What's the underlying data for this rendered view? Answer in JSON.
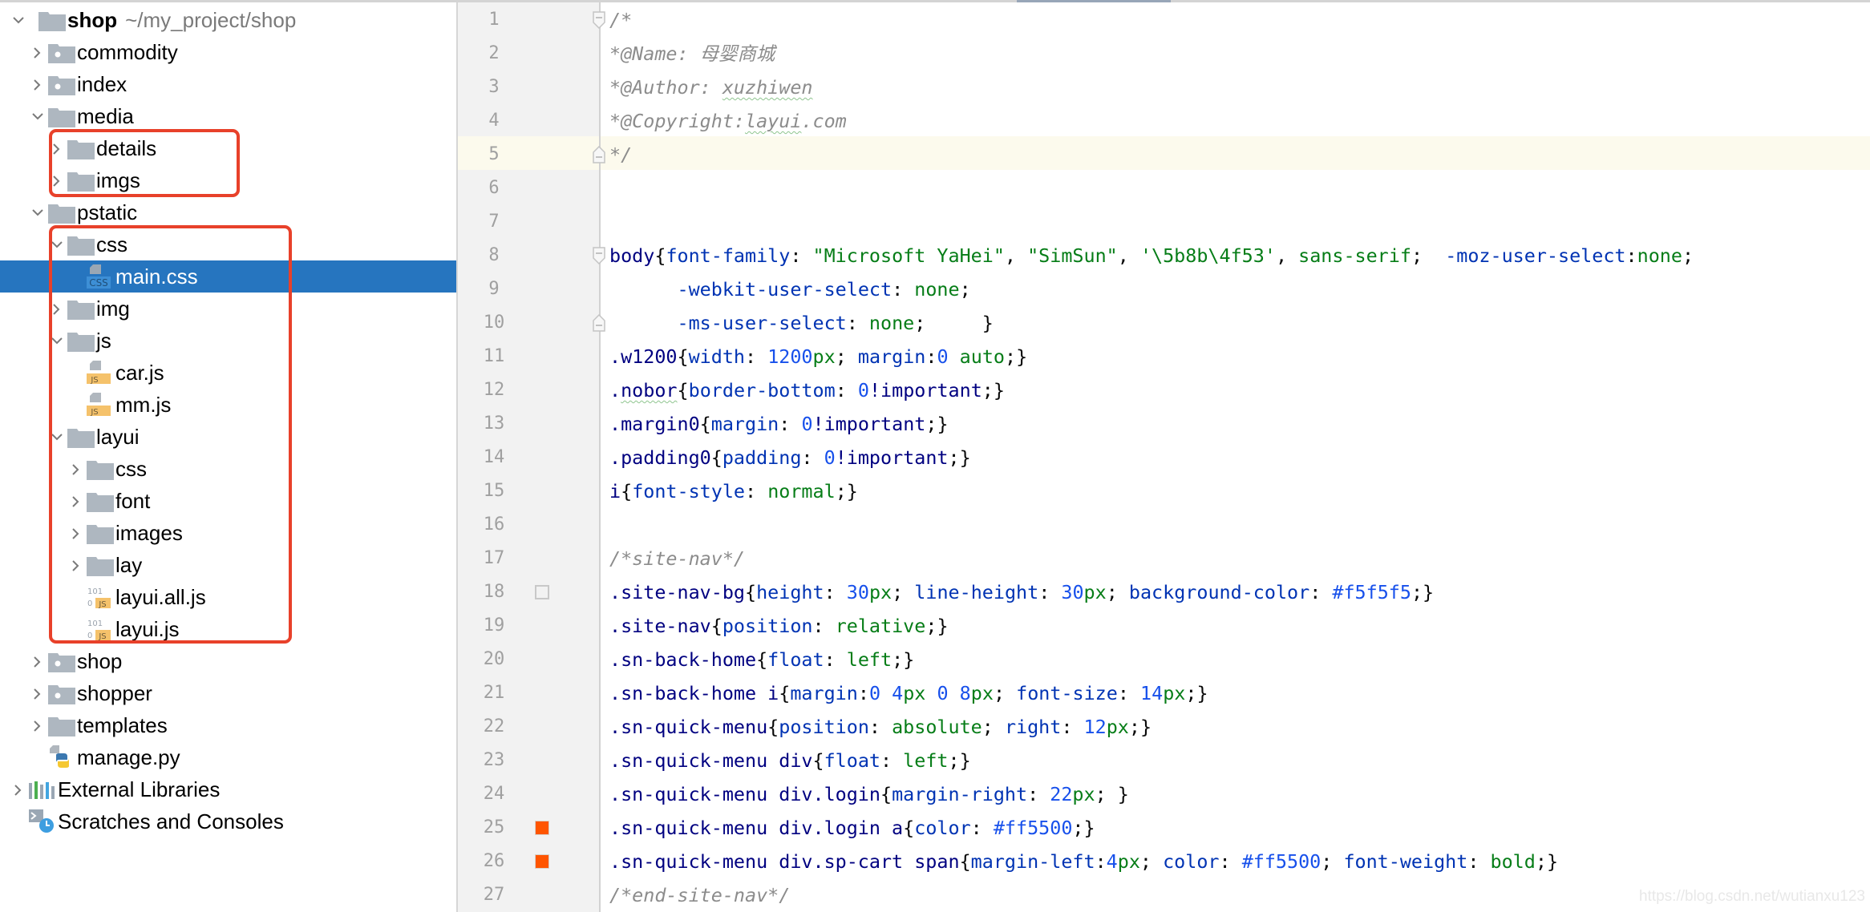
{
  "project_tree": {
    "root": {
      "label": "shop",
      "path": "~/my_project/shop"
    },
    "rows": [
      {
        "label": "commodity",
        "depth": 1,
        "kind": "module",
        "state": "collapsed"
      },
      {
        "label": "index",
        "depth": 1,
        "kind": "module",
        "state": "collapsed"
      },
      {
        "label": "media",
        "depth": 1,
        "kind": "folder",
        "state": "expanded"
      },
      {
        "label": "details",
        "depth": 2,
        "kind": "folder",
        "state": "collapsed"
      },
      {
        "label": "imgs",
        "depth": 2,
        "kind": "folder",
        "state": "collapsed"
      },
      {
        "label": "pstatic",
        "depth": 1,
        "kind": "folder",
        "state": "expanded"
      },
      {
        "label": "css",
        "depth": 2,
        "kind": "folder",
        "state": "expanded"
      },
      {
        "label": "main.css",
        "depth": 3,
        "kind": "css-file",
        "state": "leaf",
        "selected": true
      },
      {
        "label": "img",
        "depth": 2,
        "kind": "folder",
        "state": "collapsed"
      },
      {
        "label": "js",
        "depth": 2,
        "kind": "folder",
        "state": "expanded"
      },
      {
        "label": "car.js",
        "depth": 3,
        "kind": "js-file",
        "state": "leaf"
      },
      {
        "label": "mm.js",
        "depth": 3,
        "kind": "js-file",
        "state": "leaf"
      },
      {
        "label": "layui",
        "depth": 2,
        "kind": "folder",
        "state": "expanded"
      },
      {
        "label": "css",
        "depth": 3,
        "kind": "folder",
        "state": "collapsed"
      },
      {
        "label": "font",
        "depth": 3,
        "kind": "folder",
        "state": "collapsed"
      },
      {
        "label": "images",
        "depth": 3,
        "kind": "folder",
        "state": "collapsed"
      },
      {
        "label": "lay",
        "depth": 3,
        "kind": "folder",
        "state": "collapsed"
      },
      {
        "label": "layui.all.js",
        "depth": 3,
        "kind": "min-js-file",
        "state": "leaf"
      },
      {
        "label": "layui.js",
        "depth": 3,
        "kind": "min-js-file",
        "state": "leaf"
      },
      {
        "label": "shop",
        "depth": 1,
        "kind": "module",
        "state": "collapsed"
      },
      {
        "label": "shopper",
        "depth": 1,
        "kind": "module",
        "state": "collapsed"
      },
      {
        "label": "templates",
        "depth": 1,
        "kind": "folder",
        "state": "collapsed"
      },
      {
        "label": "manage.py",
        "depth": 1,
        "kind": "python-file",
        "state": "leaf"
      },
      {
        "label": "External Libraries",
        "depth": 0,
        "kind": "libraries",
        "state": "collapsed"
      },
      {
        "label": "Scratches and Consoles",
        "depth": 0,
        "kind": "scratches",
        "state": "leaf"
      }
    ],
    "highlight_boxes": [
      {
        "covers": [
          "details",
          "imgs"
        ],
        "color": "#e8412a"
      },
      {
        "covers": [
          "css",
          "main.css",
          "img",
          "js",
          "car.js",
          "mm.js",
          "layui",
          "css",
          "font",
          "images",
          "lay",
          "layui.all.js",
          "layui.js"
        ],
        "color": "#e8412a"
      }
    ]
  },
  "editor": {
    "file": "main.css",
    "current_line": 5,
    "gutter_markers": [
      {
        "line": 18,
        "type": "empty-square"
      },
      {
        "line": 25,
        "type": "color",
        "color": "#ff5500"
      },
      {
        "line": 26,
        "type": "color",
        "color": "#ff5500"
      }
    ],
    "fold_markers": [
      {
        "line": 1,
        "type": "start"
      },
      {
        "line": 5,
        "type": "end"
      },
      {
        "line": 8,
        "type": "start"
      },
      {
        "line": 10,
        "type": "end"
      }
    ],
    "lines": [
      [
        [
          "com",
          "/*"
        ]
      ],
      [
        [
          "com",
          "*@Name: 母婴商城"
        ]
      ],
      [
        [
          "com",
          "*@Author: "
        ],
        [
          "com-typo",
          "xuzhiwen"
        ]
      ],
      [
        [
          "com",
          "*@Copyright:"
        ],
        [
          "com-typo",
          "layui"
        ],
        [
          "com",
          ".com"
        ]
      ],
      [
        [
          "com",
          "*/"
        ]
      ],
      [],
      [],
      [
        [
          "sel",
          "body"
        ],
        [
          "punc",
          "{"
        ],
        [
          "prop",
          "font-family"
        ],
        [
          "punc",
          ": "
        ],
        [
          "str",
          "\"Microsoft YaHei\""
        ],
        [
          "punc",
          ", "
        ],
        [
          "str",
          "\"SimSun\""
        ],
        [
          "punc",
          ", "
        ],
        [
          "str",
          "'\\5b8b\\4f53'"
        ],
        [
          "punc",
          ", "
        ],
        [
          "val",
          "sans-serif"
        ],
        [
          "punc",
          ";  "
        ],
        [
          "prop",
          "-moz-user-select"
        ],
        [
          "punc",
          ":"
        ],
        [
          "val",
          "none"
        ],
        [
          "punc",
          ";"
        ]
      ],
      [
        [
          "punc",
          "      "
        ],
        [
          "prop",
          "-webkit-user-select"
        ],
        [
          "punc",
          ": "
        ],
        [
          "val",
          "none"
        ],
        [
          "punc",
          ";"
        ]
      ],
      [
        [
          "punc",
          "      "
        ],
        [
          "prop",
          "-ms-user-select"
        ],
        [
          "punc",
          ": "
        ],
        [
          "val",
          "none"
        ],
        [
          "punc",
          ";     }"
        ]
      ],
      [
        [
          "sel",
          ".w1200"
        ],
        [
          "punc",
          "{"
        ],
        [
          "prop",
          "width"
        ],
        [
          "punc",
          ": "
        ],
        [
          "num",
          "1200"
        ],
        [
          "unit",
          "px"
        ],
        [
          "punc",
          "; "
        ],
        [
          "prop",
          "margin"
        ],
        [
          "punc",
          ":"
        ],
        [
          "num",
          "0"
        ],
        [
          "punc",
          " "
        ],
        [
          "val",
          "auto"
        ],
        [
          "punc",
          ";}"
        ]
      ],
      [
        [
          "sel",
          "."
        ],
        [
          "sel-typo",
          "nobor"
        ],
        [
          "punc",
          "{"
        ],
        [
          "prop",
          "border-bottom"
        ],
        [
          "punc",
          ": "
        ],
        [
          "num",
          "0"
        ],
        [
          "imp",
          "!important"
        ],
        [
          "punc",
          ";}"
        ]
      ],
      [
        [
          "sel",
          ".margin0"
        ],
        [
          "punc",
          "{"
        ],
        [
          "prop",
          "margin"
        ],
        [
          "punc",
          ": "
        ],
        [
          "num",
          "0"
        ],
        [
          "imp",
          "!important"
        ],
        [
          "punc",
          ";}"
        ]
      ],
      [
        [
          "sel",
          ".padding0"
        ],
        [
          "punc",
          "{"
        ],
        [
          "prop",
          "padding"
        ],
        [
          "punc",
          ": "
        ],
        [
          "num",
          "0"
        ],
        [
          "imp",
          "!important"
        ],
        [
          "punc",
          ";}"
        ]
      ],
      [
        [
          "sel",
          "i"
        ],
        [
          "punc",
          "{"
        ],
        [
          "prop",
          "font-style"
        ],
        [
          "punc",
          ": "
        ],
        [
          "val",
          "normal"
        ],
        [
          "punc",
          ";}"
        ]
      ],
      [],
      [
        [
          "com",
          "/*site-nav*/"
        ]
      ],
      [
        [
          "sel",
          ".site-nav-bg"
        ],
        [
          "punc",
          "{"
        ],
        [
          "prop",
          "height"
        ],
        [
          "punc",
          ": "
        ],
        [
          "num",
          "30"
        ],
        [
          "unit",
          "px"
        ],
        [
          "punc",
          "; "
        ],
        [
          "prop",
          "line-height"
        ],
        [
          "punc",
          ": "
        ],
        [
          "num",
          "30"
        ],
        [
          "unit",
          "px"
        ],
        [
          "punc",
          "; "
        ],
        [
          "prop",
          "background-color"
        ],
        [
          "punc",
          ": "
        ],
        [
          "hex",
          "#f5f5f5"
        ],
        [
          "punc",
          ";}"
        ]
      ],
      [
        [
          "sel",
          ".site-nav"
        ],
        [
          "punc",
          "{"
        ],
        [
          "prop",
          "position"
        ],
        [
          "punc",
          ": "
        ],
        [
          "val",
          "relative"
        ],
        [
          "punc",
          ";}"
        ]
      ],
      [
        [
          "sel",
          ".sn-back-home"
        ],
        [
          "punc",
          "{"
        ],
        [
          "prop",
          "float"
        ],
        [
          "punc",
          ": "
        ],
        [
          "val",
          "left"
        ],
        [
          "punc",
          ";}"
        ]
      ],
      [
        [
          "sel",
          ".sn-back-home i"
        ],
        [
          "punc",
          "{"
        ],
        [
          "prop",
          "margin"
        ],
        [
          "punc",
          ":"
        ],
        [
          "num",
          "0"
        ],
        [
          "punc",
          " "
        ],
        [
          "num",
          "4"
        ],
        [
          "unit",
          "px"
        ],
        [
          "punc",
          " "
        ],
        [
          "num",
          "0"
        ],
        [
          "punc",
          " "
        ],
        [
          "num",
          "8"
        ],
        [
          "unit",
          "px"
        ],
        [
          "punc",
          "; "
        ],
        [
          "prop",
          "font-size"
        ],
        [
          "punc",
          ": "
        ],
        [
          "num",
          "14"
        ],
        [
          "unit",
          "px"
        ],
        [
          "punc",
          ";}"
        ]
      ],
      [
        [
          "sel",
          ".sn-quick-menu"
        ],
        [
          "punc",
          "{"
        ],
        [
          "prop",
          "position"
        ],
        [
          "punc",
          ": "
        ],
        [
          "val",
          "absolute"
        ],
        [
          "punc",
          "; "
        ],
        [
          "prop",
          "right"
        ],
        [
          "punc",
          ": "
        ],
        [
          "num",
          "12"
        ],
        [
          "unit",
          "px"
        ],
        [
          "punc",
          ";}"
        ]
      ],
      [
        [
          "sel",
          ".sn-quick-menu div"
        ],
        [
          "punc",
          "{"
        ],
        [
          "prop",
          "float"
        ],
        [
          "punc",
          ": "
        ],
        [
          "val",
          "left"
        ],
        [
          "punc",
          ";}"
        ]
      ],
      [
        [
          "sel",
          ".sn-quick-menu div.login"
        ],
        [
          "punc",
          "{"
        ],
        [
          "prop",
          "margin-right"
        ],
        [
          "punc",
          ": "
        ],
        [
          "num",
          "22"
        ],
        [
          "unit",
          "px"
        ],
        [
          "punc",
          "; }"
        ]
      ],
      [
        [
          "sel",
          ".sn-quick-menu div.login a"
        ],
        [
          "punc",
          "{"
        ],
        [
          "prop",
          "color"
        ],
        [
          "punc",
          ": "
        ],
        [
          "hex",
          "#ff5500"
        ],
        [
          "punc",
          ";}"
        ]
      ],
      [
        [
          "sel",
          ".sn-quick-menu div.sp-cart span"
        ],
        [
          "punc",
          "{"
        ],
        [
          "prop",
          "margin-left"
        ],
        [
          "punc",
          ":"
        ],
        [
          "num",
          "4"
        ],
        [
          "unit",
          "px"
        ],
        [
          "punc",
          "; "
        ],
        [
          "prop",
          "color"
        ],
        [
          "punc",
          ": "
        ],
        [
          "hex",
          "#ff5500"
        ],
        [
          "punc",
          "; "
        ],
        [
          "prop",
          "font-weight"
        ],
        [
          "punc",
          ": "
        ],
        [
          "val",
          "bold"
        ],
        [
          "punc",
          ";}"
        ]
      ],
      [
        [
          "com",
          "/*end-site-nav*/"
        ]
      ]
    ]
  },
  "watermark": "https://blog.csdn.net/wutianxu123",
  "colors": {
    "selection": "#2675bf",
    "highlight_box": "#e8412a",
    "current_line": "#fcfaed",
    "gutter_bg": "#f2f2f2"
  }
}
